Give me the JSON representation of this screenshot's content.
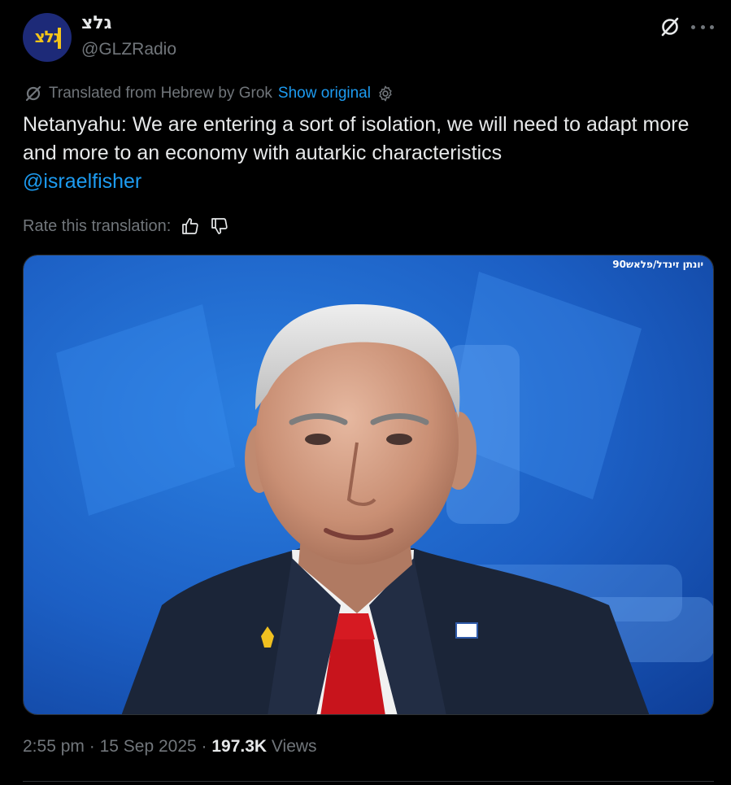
{
  "author": {
    "display_name": "גלצ",
    "handle": "@GLZRadio",
    "avatar_text": "גלצ"
  },
  "translation": {
    "notice": "Translated from Hebrew by Grok",
    "show_original": "Show original"
  },
  "tweet": {
    "text": " Netanyahu: We are entering a sort of isolation, we will need to adapt more and more to an economy with autarkic characteristics",
    "mention": "@israelfisher"
  },
  "rating": {
    "prompt": "Rate this translation:"
  },
  "media": {
    "photo_credit": "יונתן זינדל/פלאש90"
  },
  "meta": {
    "time": "2:55 pm",
    "separator": " · ",
    "date": "15 Sep 2025",
    "separator2": " · ",
    "views_count": "197.3K",
    "views_label": " Views"
  },
  "icons": {
    "grok": "grok-icon",
    "more": "more-icon",
    "settings": "gear-icon",
    "thumbs_up": "thumbs-up-icon",
    "thumbs_down": "thumbs-down-icon"
  },
  "colors": {
    "background": "#000000",
    "text": "#e7e9ea",
    "secondary": "#71767b",
    "accent": "#1d9bf0",
    "avatar_bg": "#1d2a78",
    "avatar_fg": "#f5c518"
  }
}
